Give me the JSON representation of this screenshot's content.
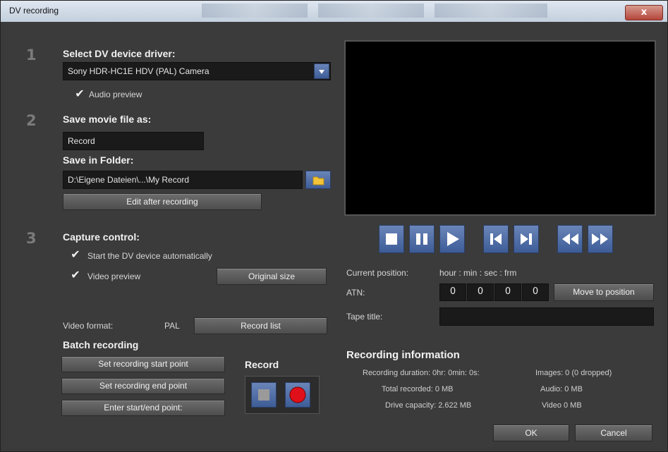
{
  "window": {
    "title": "DV recording",
    "close_label": "x"
  },
  "step1": {
    "number": "1",
    "heading": "Select DV device driver:",
    "device_value": "Sony HDR-HC1E HDV (PAL) Camera",
    "audio_preview_label": "Audio preview",
    "audio_preview_checked": true
  },
  "step2": {
    "number": "2",
    "heading": "Save movie file as:",
    "filename_value": "Record",
    "folder_heading": "Save in Folder:",
    "folder_value": "D:\\Eigene Dateien\\...\\My Record",
    "edit_after_label": "Edit after recording"
  },
  "step3": {
    "number": "3",
    "heading": "Capture control:",
    "start_auto_label": "Start the DV device automatically",
    "start_auto_checked": true,
    "video_preview_label": "Video preview",
    "video_preview_checked": true,
    "original_size_label": "Original size"
  },
  "format": {
    "label": "Video format:",
    "value": "PAL",
    "record_list_label": "Record list"
  },
  "batch": {
    "heading": "Batch recording",
    "start_point_label": "Set recording start point",
    "end_point_label": "Set recording end point",
    "enter_point_label": "Enter start/end point:"
  },
  "record": {
    "heading": "Record"
  },
  "position": {
    "current_label": "Current position:",
    "time_format": "hour : min : sec : frm",
    "atn_label": "ATN:",
    "hour": "0",
    "min": "0",
    "sec": "0",
    "frm": "0",
    "move_label": "Move to position",
    "tape_title_label": "Tape title:",
    "tape_title_value": ""
  },
  "info": {
    "heading": "Recording information",
    "duration": "Recording duration: 0hr: 0min: 0s:",
    "total": "Total recorded: 0 MB",
    "capacity": "Drive capacity: 2.622 MB",
    "images": "Images: 0 (0 dropped)",
    "audio": "Audio: 0 MB",
    "video": "Video 0 MB"
  },
  "footer": {
    "ok_label": "OK",
    "cancel_label": "Cancel"
  },
  "colors": {
    "accent_blue": "#4a6aa8",
    "record_red": "#e0101a",
    "panel": "#3b3b3b"
  }
}
